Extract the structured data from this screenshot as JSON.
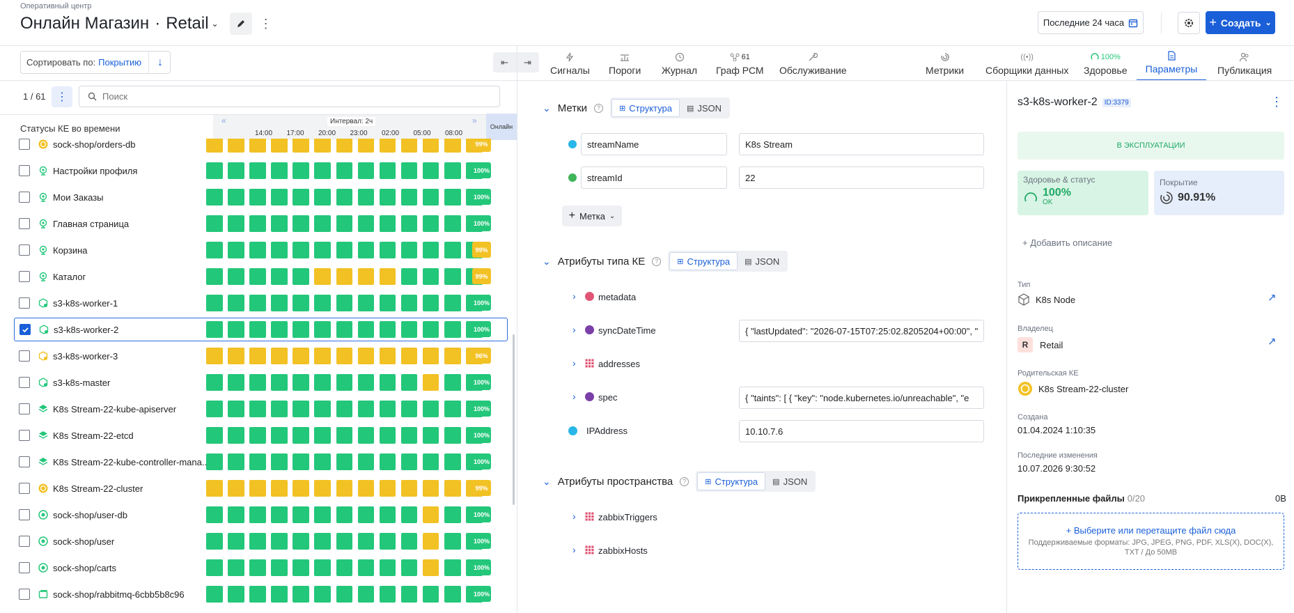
{
  "header": {
    "breadcrumb": "Оперативный центр",
    "title_main": "Онлайн Магазин",
    "title_dot": "·",
    "title_sub": "Retail",
    "range_label": "Последние 24 часа",
    "create_label": "Создать"
  },
  "toolbar": {
    "sort_label": "Сортировать по:",
    "sort_value": "Покрытию"
  },
  "tabs": {
    "signals": "Сигналы",
    "thresholds": "Пороги",
    "journal": "Журнал",
    "graph": "Граф РСМ",
    "graph_badge": "61",
    "maintenance": "Обслуживание",
    "metrics": "Метрики",
    "collectors": "Сборщики данных",
    "health": "Здоровье",
    "health_badge": "100%",
    "params": "Параметры",
    "publish": "Публикация"
  },
  "list": {
    "counter": "1 / 61",
    "search_placeholder": "Поиск",
    "statuses_title": "Статусы КЕ во времени",
    "interval_label": "Интервал: 2ч",
    "online_label": "Онлайн",
    "times": [
      "14:00",
      "17:00",
      "20:00",
      "23:00",
      "02:00",
      "05:00",
      "08:00"
    ],
    "rows": [
      {
        "name": "sock-shop/orders-db",
        "icon": "ring-icon",
        "cells": "yyyyyyyyyyyyy",
        "pct": "99%",
        "checked": false
      },
      {
        "name": "Настройки профиля",
        "icon": "globe-icon",
        "cells": "ggggggggggggg",
        "pct": "100%",
        "checked": false
      },
      {
        "name": "Мои Заказы",
        "icon": "globe-icon",
        "cells": "ggggggggggggg",
        "pct": "100%",
        "checked": false
      },
      {
        "name": "Главная страница",
        "icon": "globe-icon",
        "cells": "ggggggggggggg",
        "pct": "100%",
        "checked": false
      },
      {
        "name": "Корзина",
        "icon": "globe-icon",
        "cells": "ggggggggggggg",
        "pct": "99%",
        "checked": false
      },
      {
        "name": "Каталог",
        "icon": "globe-icon",
        "cells": "gggggyyyygggg",
        "pct": "99%",
        "checked": false
      },
      {
        "name": "s3-k8s-worker-1",
        "icon": "cube-icon",
        "cells": "ggggggggggggg",
        "pct": "100%",
        "checked": false
      },
      {
        "name": "s3-k8s-worker-2",
        "icon": "cube-icon",
        "cells": "ggggggggggggg",
        "pct": "100%",
        "checked": true
      },
      {
        "name": "s3-k8s-worker-3",
        "icon": "cube-yellow-icon",
        "cells": "yyyyyyyyyyyyy",
        "pct": "96%",
        "checked": false
      },
      {
        "name": "s3-k8s-master",
        "icon": "cube-icon",
        "cells": "ggggggggggygg",
        "pct": "100%",
        "checked": false
      },
      {
        "name": "K8s Stream-22-kube-apiserver",
        "icon": "layers-icon",
        "cells": "ggggggggggggg",
        "pct": "100%",
        "checked": false
      },
      {
        "name": "K8s Stream-22-etcd",
        "icon": "layers-icon",
        "cells": "ggggggggggggg",
        "pct": "100%",
        "checked": false
      },
      {
        "name": "K8s Stream-22-kube-controller-mana...",
        "icon": "layers-icon",
        "cells": "ggggggggggggg",
        "pct": "100%",
        "checked": false
      },
      {
        "name": "K8s Stream-22-cluster",
        "icon": "ring-icon",
        "cells": "yyyyyyyyyyyyy",
        "pct": "99%",
        "checked": false
      },
      {
        "name": "sock-shop/user-db",
        "icon": "db-icon",
        "cells": "ggggggggggygg",
        "pct": "100%",
        "checked": false
      },
      {
        "name": "sock-shop/user",
        "icon": "db-icon",
        "cells": "ggggggggggygg",
        "pct": "100%",
        "checked": false
      },
      {
        "name": "sock-shop/carts",
        "icon": "db-icon",
        "cells": "ggggggggggygg",
        "pct": "100%",
        "checked": false
      },
      {
        "name": "sock-shop/rabbitmq-6cbb5b8c96",
        "icon": "box-icon",
        "cells": "ggggggggggggg",
        "pct": "100%",
        "checked": false
      }
    ]
  },
  "params": {
    "labels_title": "Метки",
    "structure_label": "Структура",
    "json_label": "JSON",
    "labels": [
      {
        "key": "streamName",
        "value": "K8s Stream",
        "color": "#29b6e8"
      },
      {
        "key": "streamId",
        "value": "22",
        "color": "#3fb55a"
      }
    ],
    "add_label": "Метка",
    "type_attrs_title": "Атрибуты типа КЕ",
    "type_attrs": [
      {
        "key": "metadata",
        "value": "",
        "icon": "dot",
        "color": "#e05575",
        "expandable": true
      },
      {
        "key": "syncDateTime",
        "value": "{ \"lastUpdated\": \"2026-07-15T07:25:02.8205204+00:00\", \"",
        "icon": "dot",
        "color": "#7b3fa8",
        "expandable": true
      },
      {
        "key": "addresses",
        "value": "",
        "icon": "grid",
        "color": "#e05575",
        "expandable": true
      },
      {
        "key": "spec",
        "value": "{ \"taints\": [ {  \"key\": \"node.kubernetes.io/unreachable\",  \"e",
        "icon": "dot",
        "color": "#7b3fa8",
        "expandable": true
      },
      {
        "key": "IPAddress",
        "value": "10.10.7.6",
        "icon": "dot",
        "color": "#29b6e8",
        "expandable": false
      }
    ],
    "space_attrs_title": "Атрибуты пространства",
    "space_attrs": [
      {
        "key": "zabbixTriggers",
        "icon": "grid",
        "color": "#e05575"
      },
      {
        "key": "zabbixHosts",
        "icon": "grid",
        "color": "#e05575"
      }
    ]
  },
  "detail": {
    "name": "s3-k8s-worker-2",
    "id": "ID:3379",
    "status": "В ЭКСПЛУАТАЦИИ",
    "health_title": "Здоровье & статус",
    "health_value": "100%",
    "health_state": "OK",
    "coverage_title": "Покрытие",
    "coverage_value": "90.91%",
    "add_description": "+ Добавить описание",
    "type_label": "Тип",
    "type_value": "K8s Node",
    "owner_label": "Владелец",
    "owner_initial": "R",
    "owner_value": "Retail",
    "parent_label": "Родительская КЕ",
    "parent_value": "K8s Stream-22-cluster",
    "created_label": "Создана",
    "created_value": "01.04.2024 1:10:35",
    "modified_label": "Последние изменения",
    "modified_value": "10.07.2026 9:30:52",
    "files_label": "Прикрепленные файлы",
    "files_count": "0/20",
    "files_size": "0B",
    "upload_link": "+ Выберите или перетащите файл сюда",
    "upload_hint": "Поддерживаемые форматы: JPG, JPEG, PNG, PDF, XLS(X), DOC(X), TXT / До 50MB"
  },
  "colors": {
    "accent": "#1a5fd8",
    "green": "#23c77a",
    "yellow": "#f2c124"
  }
}
